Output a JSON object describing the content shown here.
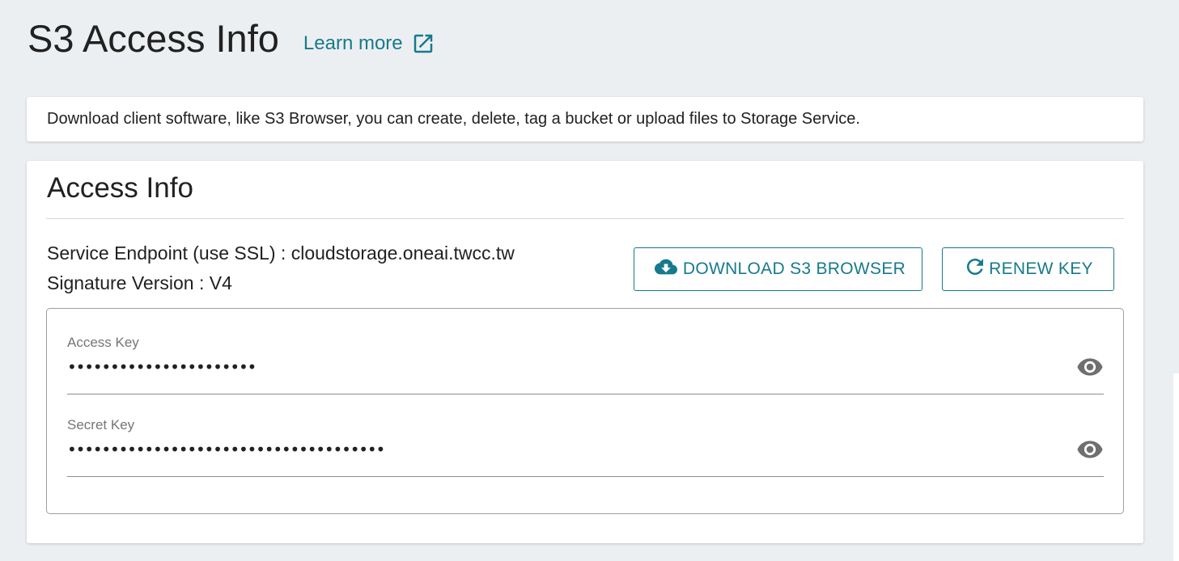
{
  "header": {
    "title": "S3 Access Info",
    "learn_more_label": "Learn more"
  },
  "info": {
    "text": "Download client software, like S3 Browser, you can create, delete, tag a bucket or upload files to Storage Service."
  },
  "access_card": {
    "title": "Access Info",
    "endpoint_line": "Service Endpoint (use SSL) : cloudstorage.oneai.twcc.tw",
    "signature_line": "Signature Version : V4",
    "download_button_label": "DOWNLOAD S3 BROWSER",
    "renew_button_label": "RENEW KEY",
    "access_key": {
      "label": "Access Key",
      "value": "••••••••••••••••••••••"
    },
    "secret_key": {
      "label": "Secret Key",
      "value": "•••••••••••••••••••••••••••••••••••••"
    }
  },
  "colors": {
    "accent": "#177a8c",
    "background": "#eceff1",
    "card": "#ffffff",
    "text": "#212121",
    "muted_label": "#757575",
    "icon_gray": "#6f6f6f"
  },
  "icons": {
    "learn_more": "external-link-icon",
    "download": "cloud-download-icon",
    "renew": "refresh-icon",
    "reveal": "eye-icon"
  }
}
